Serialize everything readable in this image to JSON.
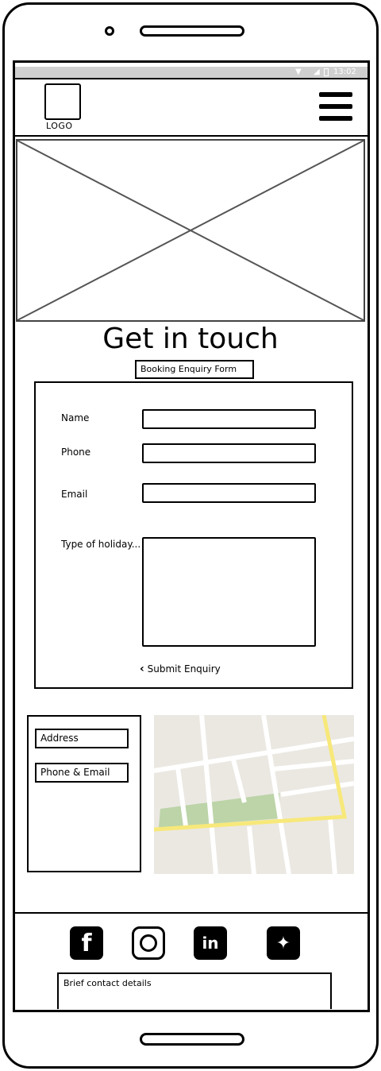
{
  "status_bar": {
    "time": "13:02"
  },
  "header": {
    "logo_text": "LOGO"
  },
  "page": {
    "title": "Get in touch"
  },
  "form": {
    "label": "Booking Enquiry Form",
    "fields": [
      {
        "label": "Name",
        "value": ""
      },
      {
        "label": "Phone",
        "value": ""
      },
      {
        "label": "Email",
        "value": ""
      },
      {
        "label": "Type of holiday...",
        "value": ""
      }
    ],
    "submit_label": "Submit Enquiry"
  },
  "contact": {
    "address_label": "Address",
    "phone_email_label": "Phone & Email"
  },
  "footer": {
    "social": [
      "facebook",
      "instagram",
      "linkedin",
      "twitter"
    ],
    "brief_text": "Brief contact details"
  },
  "colors": {
    "status_bar": "#d0d0d0",
    "map_park": "#bcd4a8",
    "map_road_major": "#f7e87a"
  }
}
